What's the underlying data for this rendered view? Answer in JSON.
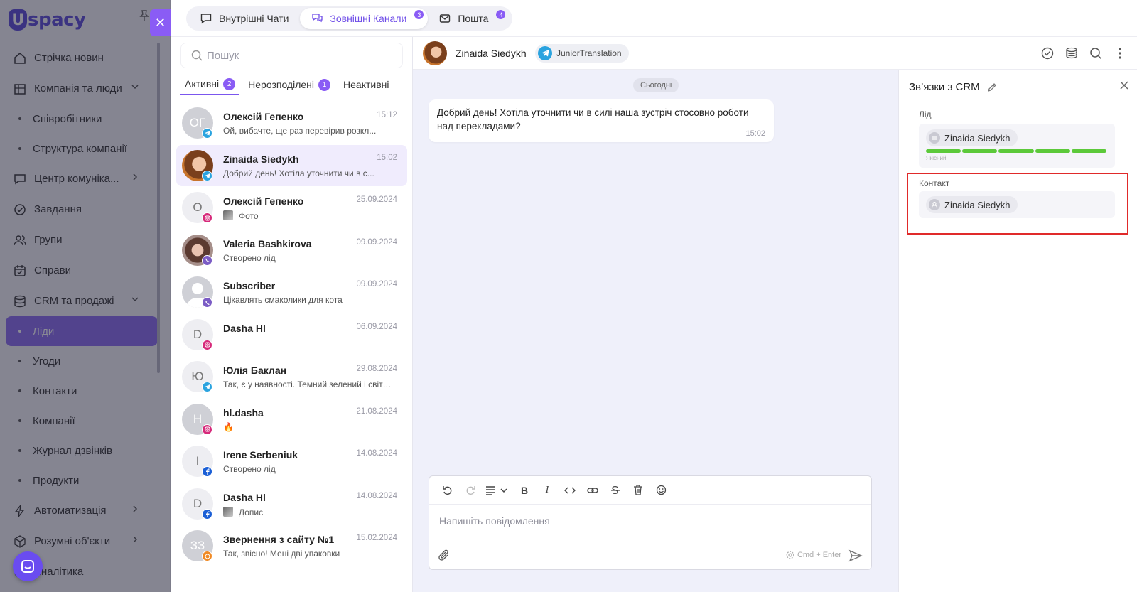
{
  "sidebar": {
    "logo_text": "spacy",
    "logo_letter": "U",
    "items": [
      {
        "label": "Стрічка новин",
        "icon": "home-icon",
        "type": "item"
      },
      {
        "label": "Компанія та люди",
        "icon": "building-icon",
        "type": "item",
        "chevron": "down"
      },
      {
        "label": "Співробітники",
        "type": "sub"
      },
      {
        "label": "Структура компанії",
        "type": "sub"
      },
      {
        "label": "Центр комуніка...",
        "icon": "chat-icon",
        "type": "item",
        "chevron": "right"
      },
      {
        "label": "Завдання",
        "icon": "check-circle-icon",
        "type": "item"
      },
      {
        "label": "Групи",
        "icon": "users-icon",
        "type": "item"
      },
      {
        "label": "Справи",
        "icon": "calendar-icon",
        "type": "item"
      },
      {
        "label": "CRM та продажі",
        "icon": "database-icon",
        "type": "item",
        "chevron": "down"
      },
      {
        "label": "Ліди",
        "type": "sub",
        "active": true
      },
      {
        "label": "Угоди",
        "type": "sub"
      },
      {
        "label": "Контакти",
        "type": "sub"
      },
      {
        "label": "Компанії",
        "type": "sub"
      },
      {
        "label": "Журнал дзвінків",
        "type": "sub"
      },
      {
        "label": "Продукти",
        "type": "sub"
      },
      {
        "label": "Автоматизація",
        "icon": "bolt-icon",
        "type": "item",
        "chevron": "right"
      },
      {
        "label": "Розумні об'єкти",
        "icon": "cube-icon",
        "type": "item",
        "chevron": "right"
      },
      {
        "label": "Аналітика",
        "icon": "chart-icon",
        "type": "item"
      }
    ]
  },
  "top_tabs": [
    {
      "label": "Внутрішні Чати",
      "icon": "chat-bubble-icon",
      "badge": null,
      "active": false
    },
    {
      "label": "Зовнішні Канали",
      "icon": "channels-icon",
      "badge": "3",
      "active": true
    },
    {
      "label": "Пошта",
      "icon": "mail-icon",
      "badge": "4",
      "active": false
    }
  ],
  "chat_list": {
    "search_placeholder": "Пошук",
    "subtabs": [
      {
        "label": "Активні",
        "count": "2",
        "active": true
      },
      {
        "label": "Нерозподілені",
        "count": "1",
        "active": false
      },
      {
        "label": "Неактивні",
        "count": null,
        "active": false
      }
    ],
    "items": [
      {
        "name": "Олексій Гепенко",
        "time": "15:12",
        "preview": "Ой, вибачте, ще раз перевірив розкл...",
        "initials": "ОГ",
        "avatar": "gray",
        "channel": "telegram"
      },
      {
        "name": "Zinaida Siedykh",
        "time": "15:02",
        "preview": "Добрий день! Хотіла уточнити чи в с...",
        "initials": "",
        "avatar": "photo1",
        "channel": "telegram",
        "active": true
      },
      {
        "name": "Олексій Гепенко",
        "time": "25.09.2024",
        "preview": "Фото",
        "initials": "О",
        "avatar": "light",
        "channel": "instagram",
        "thumb": true
      },
      {
        "name": "Valeria Bashkirova",
        "time": "09.09.2024",
        "preview": "Створено лід",
        "initials": "",
        "avatar": "photo2",
        "channel": "viber"
      },
      {
        "name": "Subscriber",
        "time": "09.09.2024",
        "preview": "Цікавлять смаколики для кота",
        "initials": "",
        "avatar": "gray",
        "channel": "viber"
      },
      {
        "name": "Dasha Hl",
        "time": "06.09.2024",
        "preview": "",
        "initials": "D",
        "avatar": "light",
        "channel": "instagram"
      },
      {
        "name": "Юлія Баклан",
        "time": "29.08.2024",
        "preview": "Так, є у наявності. Темний зелений і світл...",
        "initials": "Ю",
        "avatar": "light",
        "channel": "telegram"
      },
      {
        "name": "hl.dasha",
        "time": "21.08.2024",
        "preview": "🔥",
        "initials": "H",
        "avatar": "gray",
        "channel": "instagram"
      },
      {
        "name": "Irene Serbeniuk",
        "time": "14.08.2024",
        "preview": "Створено лід",
        "initials": "I",
        "avatar": "light",
        "channel": "facebook"
      },
      {
        "name": "Dasha Hl",
        "time": "14.08.2024",
        "preview": "Допис",
        "initials": "D",
        "avatar": "light",
        "channel": "facebook",
        "thumb": true
      },
      {
        "name": "Звернення з сайту №1",
        "time": "15.02.2024",
        "preview": "Так, звісно! Мені дві упаковки",
        "initials": "ЗЗ",
        "avatar": "gray",
        "channel": "site"
      }
    ]
  },
  "conversation": {
    "contact_name": "Zinaida Siedykh",
    "channel_chip": "JuniorTranslation",
    "day_label": "Сьогодні",
    "message_text": "Добрий день! Хотіла уточнити чи в силі наша зустріч стосовно роботи над перекладами?",
    "message_time": "15:02",
    "composer_placeholder": "Напишіть повідомлення",
    "send_hint": "Cmd + Enter"
  },
  "crm": {
    "title": "Зв’язки з CRM",
    "lead_label": "Лід",
    "lead_name": "Zinaida Siedykh",
    "lead_quality": "Якісний",
    "lead_progress_filled": 5,
    "lead_progress_total": 5,
    "contact_label": "Контакт",
    "contact_name": "Zinaida Siedykh"
  },
  "colors": {
    "accent": "#7b56ee",
    "progress_green": "#5cc93a",
    "telegram": "#2aa3df",
    "instagram": "#d6297a",
    "viber": "#7b5cc5",
    "facebook": "#1b5fd6",
    "site": "#f08a24",
    "highlight": "#e02a2a"
  }
}
